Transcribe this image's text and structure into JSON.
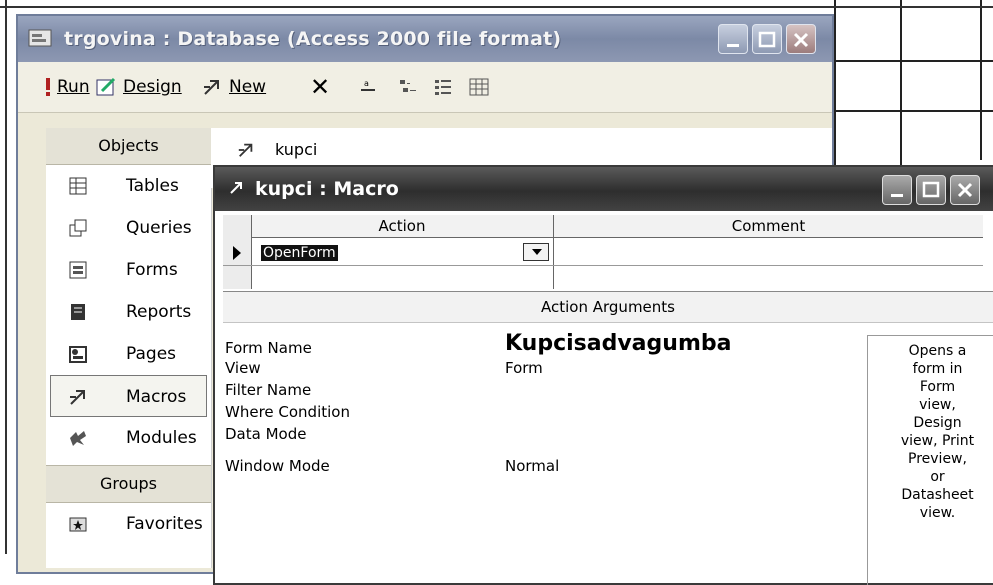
{
  "db_window": {
    "title": "trgovina : Database (Access 2000 file format)",
    "toolbar": {
      "run": "Run",
      "design": "Design",
      "new": "New",
      "delete_glyph": "✕"
    },
    "objects_header": "Objects",
    "objects": [
      {
        "label": "Tables",
        "icon": "table-icon"
      },
      {
        "label": "Queries",
        "icon": "query-icon"
      },
      {
        "label": "Forms",
        "icon": "form-icon"
      },
      {
        "label": "Reports",
        "icon": "report-icon"
      },
      {
        "label": "Pages",
        "icon": "page-icon"
      },
      {
        "label": "Macros",
        "icon": "macro-icon",
        "selected": true
      },
      {
        "label": "Modules",
        "icon": "module-icon"
      }
    ],
    "groups_header": "Groups",
    "groups": [
      {
        "label": "Favorites",
        "icon": "favorites-icon"
      }
    ],
    "list_items": [
      {
        "label": "kupci",
        "icon": "macro-icon"
      }
    ]
  },
  "macro_window": {
    "title": "kupci : Macro",
    "columns": {
      "action": "Action",
      "comment": "Comment"
    },
    "rows": [
      {
        "action": "OpenForm",
        "comment": ""
      }
    ],
    "action_arguments_title": "Action Arguments",
    "arguments": [
      {
        "label": "Form Name",
        "value": "Kupcisadvagumba"
      },
      {
        "label": "View",
        "value": "Form"
      },
      {
        "label": "Filter Name",
        "value": ""
      },
      {
        "label": "Where Condition",
        "value": ""
      },
      {
        "label": "Data Mode",
        "value": ""
      },
      {
        "label": "Window Mode",
        "value": "Normal"
      }
    ],
    "help_lines": [
      "Opens a",
      "form in",
      "Form",
      "view,",
      "Design",
      "view, Print",
      "Preview,",
      "or",
      "Datasheet",
      "view."
    ]
  }
}
